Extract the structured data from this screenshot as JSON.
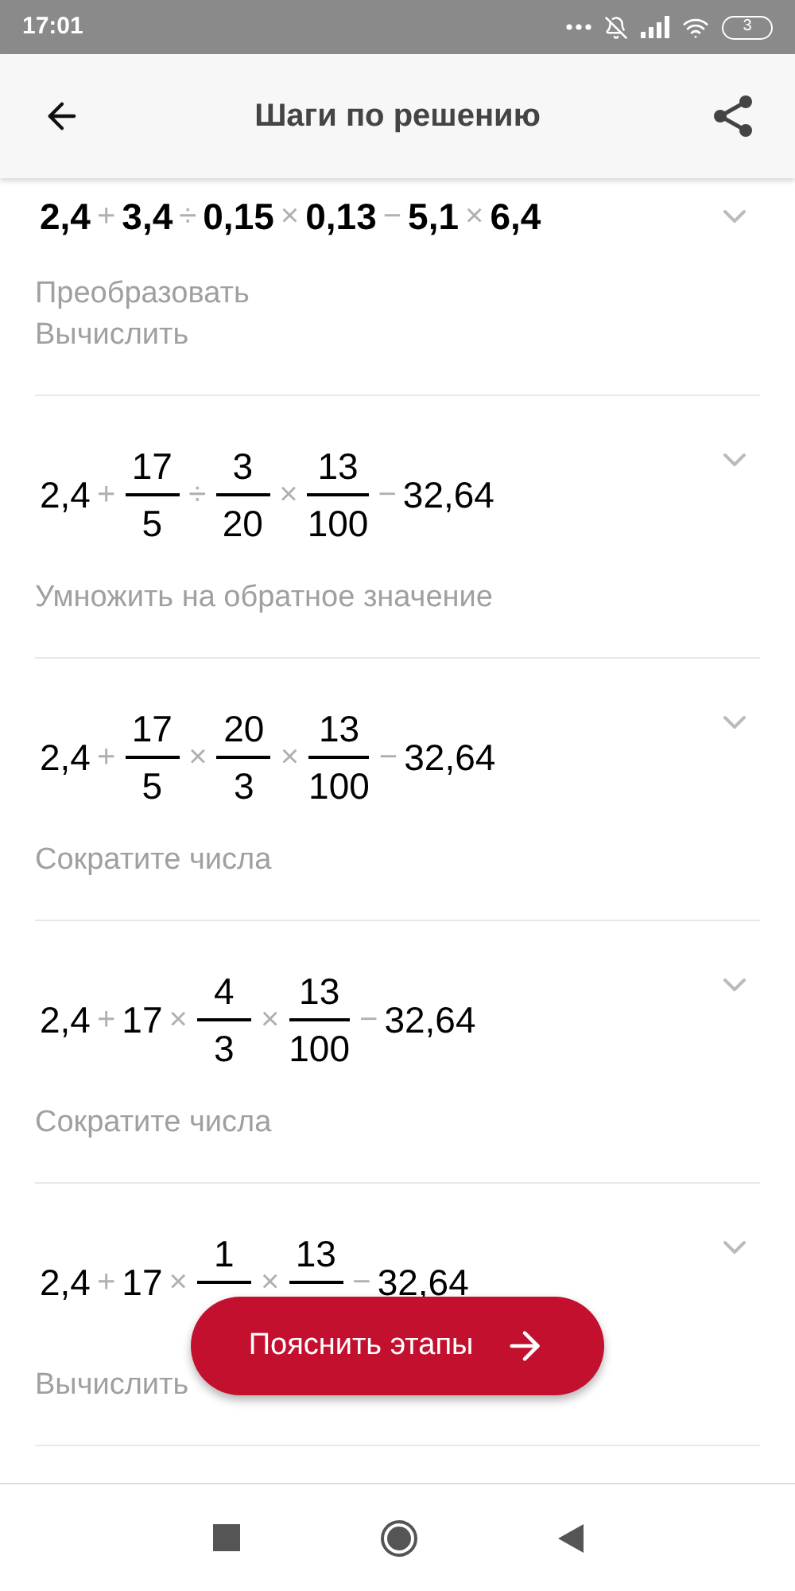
{
  "status_bar": {
    "time": "17:01",
    "battery": "3"
  },
  "header": {
    "title": "Шаги по решению"
  },
  "steps": [
    {
      "expression": [
        {
          "kind": "num",
          "text": "2,4"
        },
        {
          "kind": "op",
          "text": "+"
        },
        {
          "kind": "num",
          "text": "3,4"
        },
        {
          "kind": "op",
          "text": "÷"
        },
        {
          "kind": "num",
          "text": "0,15"
        },
        {
          "kind": "op",
          "text": "×"
        },
        {
          "kind": "num",
          "text": "0,13"
        },
        {
          "kind": "op",
          "text": "−"
        },
        {
          "kind": "num",
          "text": "5,1"
        },
        {
          "kind": "op",
          "text": "×"
        },
        {
          "kind": "num",
          "text": "6,4"
        }
      ],
      "bold": true,
      "description": [
        "Преобразовать",
        "Вычислить"
      ]
    },
    {
      "expression": [
        {
          "kind": "num",
          "text": "2,4"
        },
        {
          "kind": "op",
          "text": "+"
        },
        {
          "kind": "frac",
          "num": "17",
          "den": "5"
        },
        {
          "kind": "op",
          "text": "÷"
        },
        {
          "kind": "frac",
          "num": "3",
          "den": "20"
        },
        {
          "kind": "op",
          "text": "×"
        },
        {
          "kind": "frac",
          "num": "13",
          "den": "100"
        },
        {
          "kind": "op",
          "text": "−"
        },
        {
          "kind": "num",
          "text": "32,64"
        }
      ],
      "bold": false,
      "description": [
        "Умножить на обратное значение"
      ]
    },
    {
      "expression": [
        {
          "kind": "num",
          "text": "2,4"
        },
        {
          "kind": "op",
          "text": "+"
        },
        {
          "kind": "frac",
          "num": "17",
          "den": "5"
        },
        {
          "kind": "op",
          "text": "×"
        },
        {
          "kind": "frac",
          "num": "20",
          "den": "3"
        },
        {
          "kind": "op",
          "text": "×"
        },
        {
          "kind": "frac",
          "num": "13",
          "den": "100"
        },
        {
          "kind": "op",
          "text": "−"
        },
        {
          "kind": "num",
          "text": "32,64"
        }
      ],
      "bold": false,
      "description": [
        "Сократите числа"
      ]
    },
    {
      "expression": [
        {
          "kind": "num",
          "text": "2,4"
        },
        {
          "kind": "op",
          "text": "+"
        },
        {
          "kind": "num",
          "text": "17"
        },
        {
          "kind": "op",
          "text": "×"
        },
        {
          "kind": "frac",
          "num": "4",
          "den": "3"
        },
        {
          "kind": "op",
          "text": "×"
        },
        {
          "kind": "frac",
          "num": "13",
          "den": "100"
        },
        {
          "kind": "op",
          "text": "−"
        },
        {
          "kind": "num",
          "text": "32,64"
        }
      ],
      "bold": false,
      "description": [
        "Сократите числа"
      ]
    },
    {
      "expression": [
        {
          "kind": "num",
          "text": "2,4"
        },
        {
          "kind": "op",
          "text": "+"
        },
        {
          "kind": "num",
          "text": "17"
        },
        {
          "kind": "op",
          "text": "×"
        },
        {
          "kind": "frac",
          "num": "1"
        },
        {
          "kind": "op",
          "text": "×"
        },
        {
          "kind": "frac",
          "num": "13"
        },
        {
          "kind": "op",
          "text": "−"
        },
        {
          "kind": "num",
          "text": "32,64"
        }
      ],
      "bold": false,
      "description": [
        "Вычислить"
      ]
    }
  ],
  "fab": {
    "label": "Пояснить этапы"
  }
}
